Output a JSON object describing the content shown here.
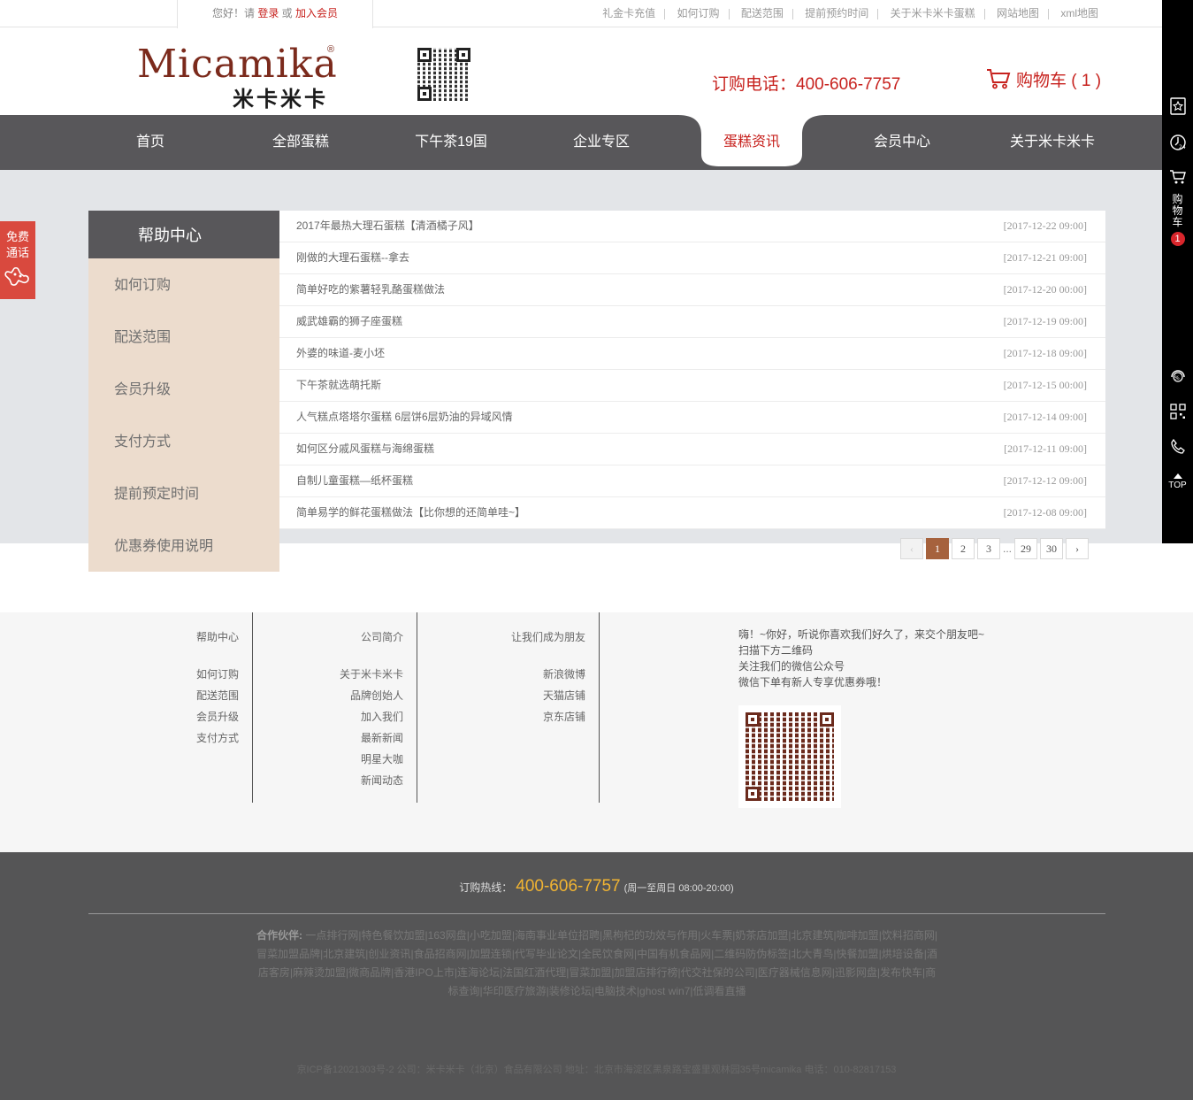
{
  "topbar": {
    "greeting": "您好！请",
    "login": "登录",
    "or": "或",
    "join": "加入会员",
    "links": [
      "礼金卡充值",
      "如何订购",
      "配送范围",
      "提前预约时间",
      "关于米卡米卡蛋糕",
      "网站地图",
      "xml地图"
    ]
  },
  "header": {
    "logo_text": "Micamika",
    "logo_reg": "®",
    "logo_cn": "米卡米卡",
    "phone_label": "订购电话：",
    "phone": "400-606-7757",
    "cart_label": "购物车",
    "cart_count": "( 1 )"
  },
  "nav": {
    "items": [
      "首页",
      "全部蛋糕",
      "下午茶19国",
      "企业专区",
      "蛋糕资讯",
      "会员中心",
      "关于米卡米卡"
    ],
    "active_index": 4
  },
  "sidebar": {
    "title": "帮助中心",
    "items": [
      "如何订购",
      "配送范围",
      "会员升级",
      "支付方式",
      "提前预定时间",
      "优惠券使用说明"
    ]
  },
  "news": [
    {
      "title": "2017年最热大理石蛋糕【清酒橘子风】",
      "date": "[2017-12-22 09:00]"
    },
    {
      "title": "刚做的大理石蛋糕--拿去",
      "date": "[2017-12-21 09:00]"
    },
    {
      "title": "简单好吃的紫薯轻乳酪蛋糕做法",
      "date": "[2017-12-20 00:00]"
    },
    {
      "title": "威武雄霸的狮子座蛋糕",
      "date": "[2017-12-19 09:00]"
    },
    {
      "title": "外婆的味道-麦小坯",
      "date": "[2017-12-18 09:00]"
    },
    {
      "title": "下午茶就选萌托斯",
      "date": "[2017-12-15 00:00]"
    },
    {
      "title": "人气糕点塔塔尔蛋糕 6层饼6层奶油的异域风情",
      "date": "[2017-12-14 09:00]"
    },
    {
      "title": "如何区分戚风蛋糕与海绵蛋糕",
      "date": "[2017-12-11 09:00]"
    },
    {
      "title": "自制儿童蛋糕—纸杯蛋糕",
      "date": "[2017-12-12 09:00]"
    },
    {
      "title": "简单易学的鲜花蛋糕做法【比你想的还简单哇~】",
      "date": "[2017-12-08 09:00]"
    }
  ],
  "pager": {
    "prev": "‹",
    "pages": [
      "1",
      "2",
      "3"
    ],
    "ellipsis": "...",
    "tail": [
      "29",
      "30"
    ],
    "next": "›",
    "current": "1"
  },
  "freecall": {
    "line1": "免费",
    "line2": "通话"
  },
  "rightbar": {
    "cart": [
      "购",
      "物",
      "车"
    ],
    "cart_badge": "1",
    "top": "TOP"
  },
  "footer": {
    "col1": {
      "title": "帮助中心",
      "links": [
        "如何订购",
        "配送范围",
        "会员升级",
        "支付方式"
      ]
    },
    "col2": {
      "title": "公司简介",
      "links": [
        "关于米卡米卡",
        "品牌创始人",
        "加入我们",
        "最新新闻",
        "明星大咖",
        "新闻动态"
      ]
    },
    "col3": {
      "title": "让我们成为朋友",
      "links": [
        "新浪微博",
        "天猫店铺",
        "京东店铺"
      ]
    },
    "wechat": [
      "嗨！~你好，听说你喜欢我们好久了，来交个朋友吧~",
      "扫描下方二维码",
      "关注我们的微信公众号",
      "微信下单有新人专享优惠券哦！"
    ],
    "hotline_label": "订购热线：",
    "hotline": "400-606-7757",
    "hours": "(周一至周日 08:00-20:00)",
    "partners_label": "合作伙伴:",
    "partners": [
      "一点排行网",
      "特色餐饮加盟",
      "163网盘",
      "小吃加盟",
      "海南事业单位招聘",
      "黑枸杞的功效与作用",
      "火车票",
      "奶茶店加盟",
      "北京建筑",
      "咖啡加盟",
      "饮料招商网",
      "冒菜加盟品牌",
      "北京建筑",
      "创业资讯",
      "食品招商网",
      "加盟连锁",
      "代写毕业论文",
      "全民饮食网",
      "中国有机食品网",
      "二维码防伪标签",
      "北大青鸟",
      "快餐加盟",
      "烘培设备",
      "酒店客房",
      "麻辣烫加盟",
      "微商品牌",
      "香港IPO上市",
      "连海论坛",
      "法国红酒代理",
      "冒菜加盟",
      "加盟店排行榜",
      "代交社保的公司",
      "医疗器械信息网",
      "迅影网盘",
      "发布快车",
      "商标查询",
      "华印医疗旅游",
      "装修论坛",
      "电脑技术",
      "ghost win7",
      "低调看直播"
    ],
    "copyright": "京ICP备12021303号-2 公司：米卡米卡（北京）食品有限公司 地址：北京市海淀区黑泉路宝盛里观林园35号micamika 电话：010-82817153"
  },
  "colors": {
    "accent": "#c7211d",
    "nav_bg": "#58575a",
    "sidebar_bg": "#ecdccd",
    "pager_active": "#a6623d",
    "hotline": "#f1b432"
  }
}
